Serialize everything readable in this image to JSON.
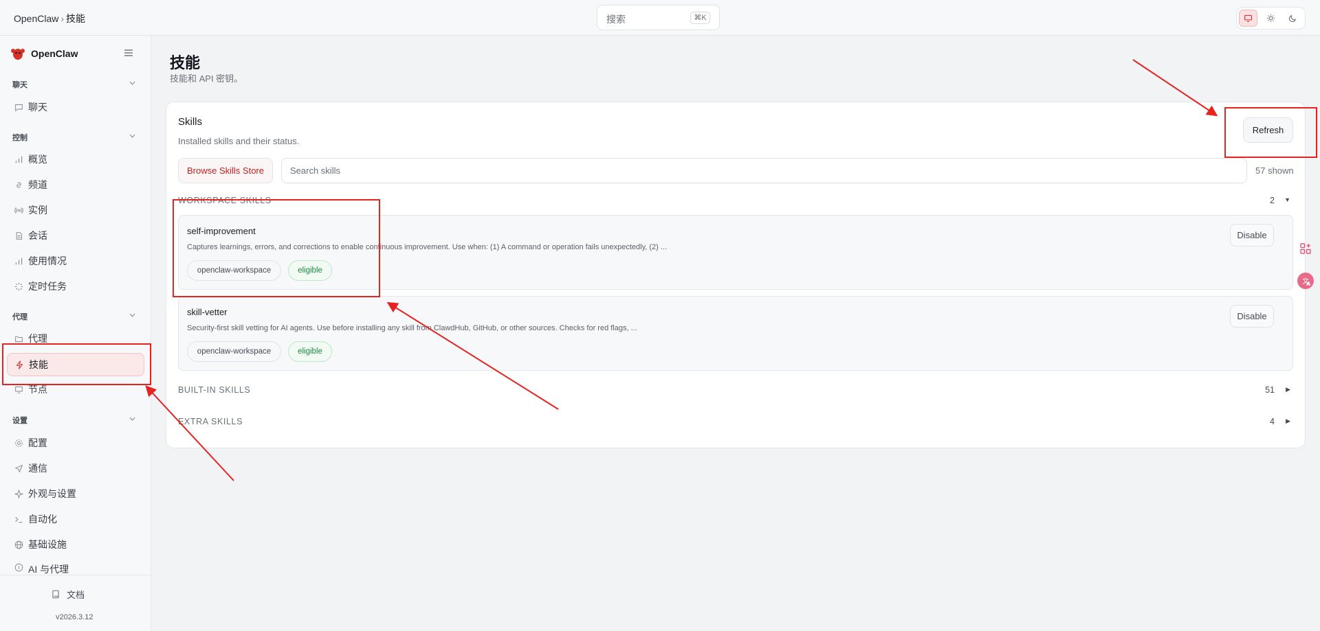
{
  "topbar": {
    "breadcrumb_root": "OpenClaw",
    "breadcrumb_sep": "›",
    "breadcrumb_current": "技能",
    "search_placeholder": "搜索",
    "search_shortcut": "⌘K",
    "theme_options": [
      "monitor-icon",
      "sun-icon",
      "moon-icon"
    ],
    "active_theme": "system"
  },
  "sidebar": {
    "brand": "OpenClaw",
    "groups": [
      {
        "label": "聊天",
        "items": [
          {
            "label": "聊天",
            "icon": "chat-bubble-icon"
          }
        ]
      },
      {
        "label": "控制",
        "items": [
          {
            "label": "概览",
            "icon": "bar-chart-icon"
          },
          {
            "label": "频道",
            "icon": "link-icon"
          },
          {
            "label": "实例",
            "icon": "broadcast-icon"
          },
          {
            "label": "会话",
            "icon": "document-icon"
          },
          {
            "label": "使用情况",
            "icon": "bar-chart-icon"
          },
          {
            "label": "定时任务",
            "icon": "spinner-icon"
          }
        ]
      },
      {
        "label": "代理",
        "items": [
          {
            "label": "代理",
            "icon": "folder-icon"
          },
          {
            "label": "技能",
            "icon": "lightning-icon",
            "active": true
          },
          {
            "label": "节点",
            "icon": "monitor-icon"
          }
        ]
      },
      {
        "label": "设置",
        "items": [
          {
            "label": "配置",
            "icon": "gear-icon"
          },
          {
            "label": "通信",
            "icon": "send-icon"
          },
          {
            "label": "外观与设置",
            "icon": "sparkle-icon"
          },
          {
            "label": "自动化",
            "icon": "terminal-icon"
          },
          {
            "label": "基础设施",
            "icon": "globe-icon"
          },
          {
            "label": "AI 与代理",
            "icon": "info-circle-icon"
          }
        ]
      }
    ],
    "docs_label": "文档",
    "version": "v2026.3.12"
  },
  "page": {
    "title": "技能",
    "subtitle": "技能和 API 密钥。"
  },
  "skills_card": {
    "title": "Skills",
    "subtitle": "Installed skills and their status.",
    "refresh_label": "Refresh",
    "browse_label": "Browse Skills Store",
    "search_placeholder": "Search skills",
    "shown_text": "57 shown",
    "sections": [
      {
        "title": "WORKSPACE SKILLS",
        "count": "2",
        "expanded": true,
        "skills": [
          {
            "name": "self-improvement",
            "description": "Captures learnings, errors, and corrections to enable continuous improvement. Use when: (1) A command or operation fails unexpectedly, (2) ...",
            "source": "openclaw-workspace",
            "status": "eligible",
            "action": "Disable"
          },
          {
            "name": "skill-vetter",
            "description": "Security-first skill vetting for AI agents. Use before installing any skill from ClawdHub, GitHub, or other sources. Checks for red flags, ...",
            "source": "openclaw-workspace",
            "status": "eligible",
            "action": "Disable"
          }
        ]
      },
      {
        "title": "BUILT-IN SKILLS",
        "count": "51",
        "expanded": false
      },
      {
        "title": "EXTRA SKILLS",
        "count": "4",
        "expanded": false
      }
    ]
  },
  "floating": [
    "apps-add-icon",
    "translate-icon"
  ],
  "colors": {
    "accent": "#c81e1e",
    "annotation": "#e8231f",
    "eligible": "#1b8a3e"
  }
}
